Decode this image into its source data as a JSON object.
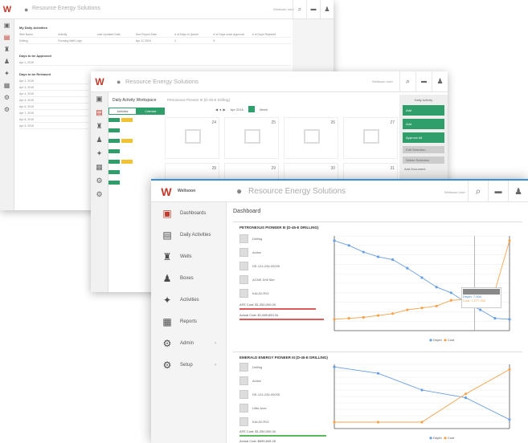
{
  "colors": {
    "accent": "#2f9e6a",
    "brand_red": "#c0392b",
    "line_blue": "#6a9fe0",
    "line_orange": "#f5a44e",
    "top_border": "#3a8fd9",
    "red_bar": "#e05a5a",
    "green_bar": "#5cb85c",
    "blue_bar": "#3a8fd9"
  },
  "app": {
    "title": "Resource Energy Solutions",
    "brand": "Wellsoon",
    "user": "Wellsoon User"
  },
  "w1": {
    "section1": "My Daily Activities",
    "cols": [
      "Well Name",
      "Activity",
      "Last Updated Date",
      "Due Report Date",
      "# of Days in Queue",
      "# of Days since Approval",
      "# of Days Rejected"
    ],
    "row": [
      "Drilling",
      "Running Well Logs",
      "",
      "Apr 11 2015",
      "2",
      "5",
      ""
    ],
    "section2": "Days to be Approved",
    "section3": "Days to be Released",
    "day_rows": [
      "Apr 1, 2015",
      "Apr 2, 2015",
      "Apr 3, 2015",
      "Apr 4, 2015",
      "Apr 5, 2015",
      "Apr 6, 2015",
      "Apr 7, 2015",
      "Apr 8, 2015",
      "Apr 9, 2015"
    ]
  },
  "w2": {
    "title": "Daily Activity Workspace",
    "subtitle": "Petronexus Pioneer III (D-45-E Drilling)",
    "month": "Apr 2016",
    "view": "Week",
    "seg": [
      "Activities",
      "Calendar"
    ],
    "days": [
      "24",
      "25",
      "26",
      "27",
      "28",
      "29",
      "30",
      "31"
    ],
    "right_title": "Daily Activity",
    "right_btns": [
      "Add",
      "Add",
      "Approve All"
    ],
    "right_gray": [
      "Edit Selection",
      "Delete Selection"
    ],
    "right_link": "Add Document"
  },
  "nav": [
    {
      "label": "Dashboards",
      "icon": "dashboard-icon",
      "glyph": "▣",
      "active": true
    },
    {
      "label": "Daily Activities",
      "icon": "daily-activities-icon",
      "glyph": "▤"
    },
    {
      "label": "Wells",
      "icon": "well-icon",
      "glyph": "♜"
    },
    {
      "label": "Boxes",
      "icon": "boxes-icon",
      "glyph": "♟"
    },
    {
      "label": "Activities",
      "icon": "activities-icon",
      "glyph": "✦"
    },
    {
      "label": "Reports",
      "icon": "reports-icon",
      "glyph": "▦"
    },
    {
      "label": "Admin",
      "icon": "admin-icon",
      "glyph": "⚙",
      "chev": "›"
    },
    {
      "label": "Setup",
      "icon": "setup-icon",
      "glyph": "⚙",
      "chev": "›"
    }
  ],
  "dashboard": {
    "heading": "Dashboard",
    "p1": {
      "title": "PETRONEXUS PIONEER III (D-45-E DRILLING)",
      "rows": [
        "Drilling",
        "Active",
        "DE-124-234-00025",
        "ACME Drill Site",
        "KAL52-R01"
      ],
      "afe": "AFE Cost: $1,250,000.00",
      "actual": "Actual Cost: $1,665,853.34"
    },
    "p2": {
      "title": "EMERALD ENERGY PIONEER III (D-45-E DRILLING)",
      "rows": [
        "Drilling",
        "Active",
        "DE-124-234-00025",
        "Little Acre",
        "KAL52-R01"
      ],
      "afe": "AFE Cost: $1,250,000.00",
      "actual": "Actual Cost: $695,845.26"
    },
    "legend": [
      "Depth",
      "Cost"
    ],
    "tooltip": {
      "title": "",
      "depth": "Depth: 7,004",
      "cost": "Cost: 1,277,000"
    }
  },
  "chart_data": [
    {
      "type": "line",
      "series": [
        {
          "name": "Depth",
          "values": [
            9.5,
            9.0,
            8.3,
            7.8,
            7.5,
            6.6,
            5.6,
            4.6,
            4.0,
            3.0,
            2.2,
            1.3,
            1.2
          ]
        },
        {
          "name": "Cost",
          "values": [
            1.2,
            1.3,
            1.4,
            1.6,
            1.8,
            2.2,
            2.4,
            2.6,
            3.2,
            3.3,
            3.6,
            4.2,
            9.5
          ]
        }
      ],
      "ylim": [
        0,
        10
      ],
      "grid": true,
      "legend": "bottom"
    },
    {
      "type": "line",
      "series": [
        {
          "name": "Depth",
          "values": [
            9.6,
            8.6,
            6.0,
            4.8,
            1.4
          ]
        },
        {
          "name": "Cost",
          "values": [
            1.0,
            1.0,
            1.0,
            5.4,
            9.2
          ]
        }
      ],
      "ylim": [
        0,
        10
      ],
      "grid": true,
      "legend": "bottom"
    }
  ]
}
